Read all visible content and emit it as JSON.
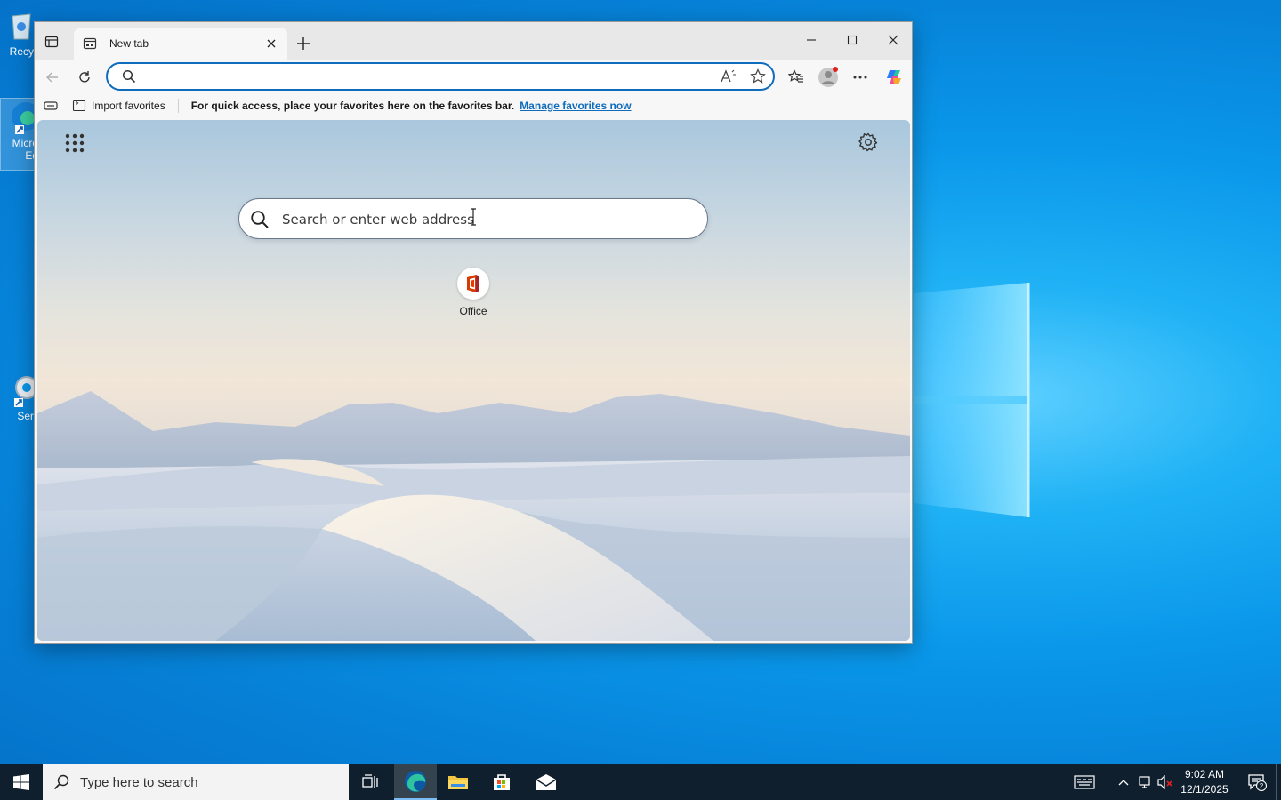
{
  "desktop": {
    "icons": [
      {
        "label": "Recyc"
      },
      {
        "label": "Micro\nEd"
      },
      {
        "label": "Serv"
      }
    ]
  },
  "browser": {
    "tab": {
      "title": "New tab"
    },
    "address": {
      "value": "",
      "placeholder": ""
    },
    "favorites_bar": {
      "import_label": "Import favorites",
      "hint": "For quick access, place your favorites here on the favorites bar.",
      "manage_link": "Manage favorites now"
    },
    "ntp": {
      "search_placeholder": "Search or enter web address",
      "tiles": [
        {
          "label": "Office"
        }
      ]
    }
  },
  "taskbar": {
    "search_placeholder": "Type here to search",
    "clock": {
      "time": "9:02 AM",
      "date": "12/1/2025"
    },
    "notification_count": "2"
  },
  "colors": {
    "accent": "#0f6cbd",
    "taskbar": "#0f1f2e",
    "desktop": "#0a97ea"
  }
}
